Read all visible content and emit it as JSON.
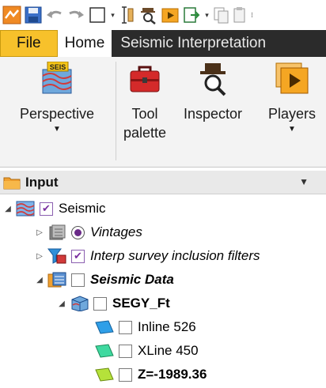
{
  "quick_access": {
    "icons": [
      "app-icon",
      "save-icon",
      "undo-icon",
      "redo-icon",
      "blank-page-icon",
      "ruler-icon",
      "inspector-icon",
      "player-icon",
      "import-icon",
      "copy-icon",
      "paste-icon"
    ]
  },
  "tabs": [
    "File",
    "Home",
    "Seismic Interpretation"
  ],
  "ribbon": {
    "buttons": [
      {
        "label_line1": "Perspective",
        "label_line2": "",
        "badge": "SEIS",
        "dropdown": true
      },
      {
        "label_line1": "Tool",
        "label_line2": "palette",
        "dropdown": false
      },
      {
        "label_line1": "Inspector",
        "label_line2": "",
        "dropdown": false
      },
      {
        "label_line1": "Players",
        "label_line2": "",
        "dropdown": true
      }
    ]
  },
  "panel": {
    "title": "Input"
  },
  "tree": {
    "seismic": "Seismic",
    "vintages": "Vintages",
    "interp_filters": "Interp survey inclusion filters",
    "seismic_data": "Seismic Data",
    "segy": "SEGY_Ft",
    "inline": "Inline 526",
    "xline": "XLine 450",
    "z": "Z=-1989.36"
  },
  "colors": {
    "tab_bar": "#2b2b2b",
    "file_tab": "#f7c12b",
    "accent_purple": "#7a2fa0"
  }
}
